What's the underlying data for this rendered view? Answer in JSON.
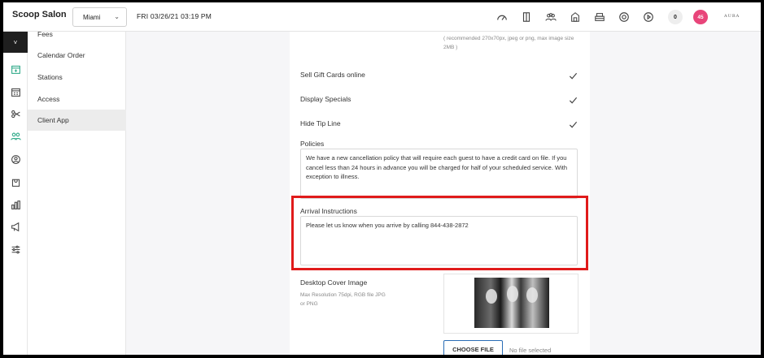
{
  "header": {
    "brand": "Scoop Salon",
    "location": "Miami",
    "datetime": "FRI 03/26/21   03:19 PM",
    "icons": [
      "speedometer-icon",
      "door-icon",
      "group-icon",
      "building-icon",
      "register-icon",
      "lifebuoy-icon",
      "play-icon"
    ],
    "count_badge": "0",
    "notification_badge": "45",
    "aura_logo": "AURA"
  },
  "rail": {
    "toggle": "˅",
    "icons": [
      "calendar-plus-icon",
      "calendar-grid-icon",
      "scissors-icon",
      "people-icon",
      "user-circle-icon",
      "bag-icon",
      "bar-chart-icon",
      "megaphone-icon",
      "sliders-icon"
    ],
    "active": "people-icon"
  },
  "submenu": {
    "items": [
      "Fees",
      "Calendar Order",
      "Stations",
      "Access",
      "Client App"
    ],
    "active": "Client App"
  },
  "form": {
    "logo_hint": "( recommended 270x70px, jpeg or png, max image size 2MB )",
    "toggles": [
      {
        "label": "Sell Gift Cards online",
        "checked": true
      },
      {
        "label": "Display Specials",
        "checked": true
      },
      {
        "label": "Hide Tip Line",
        "checked": true
      }
    ],
    "policies_label": "Policies",
    "policies_text": "We have a new cancellation policy that will require each guest to have a credit card on file. If you cancel less than 24 hours in advance you will be charged for half of your scheduled service. With exception to illness.",
    "arrival_label": "Arrival Instructions",
    "arrival_text": "Please let us know when you arrive by calling  844-438-2872",
    "cover_label": "Desktop Cover Image",
    "cover_hint": "Max Resolution 75dpi, RGB file JPG or PNG",
    "choose_file": "CHOOSE FILE",
    "no_file": "No file selected"
  },
  "colors": {
    "accent": "#2ba886",
    "highlight": "#e01b1b",
    "badge": "#e8457a",
    "file_button_border": "#2a6db5"
  }
}
